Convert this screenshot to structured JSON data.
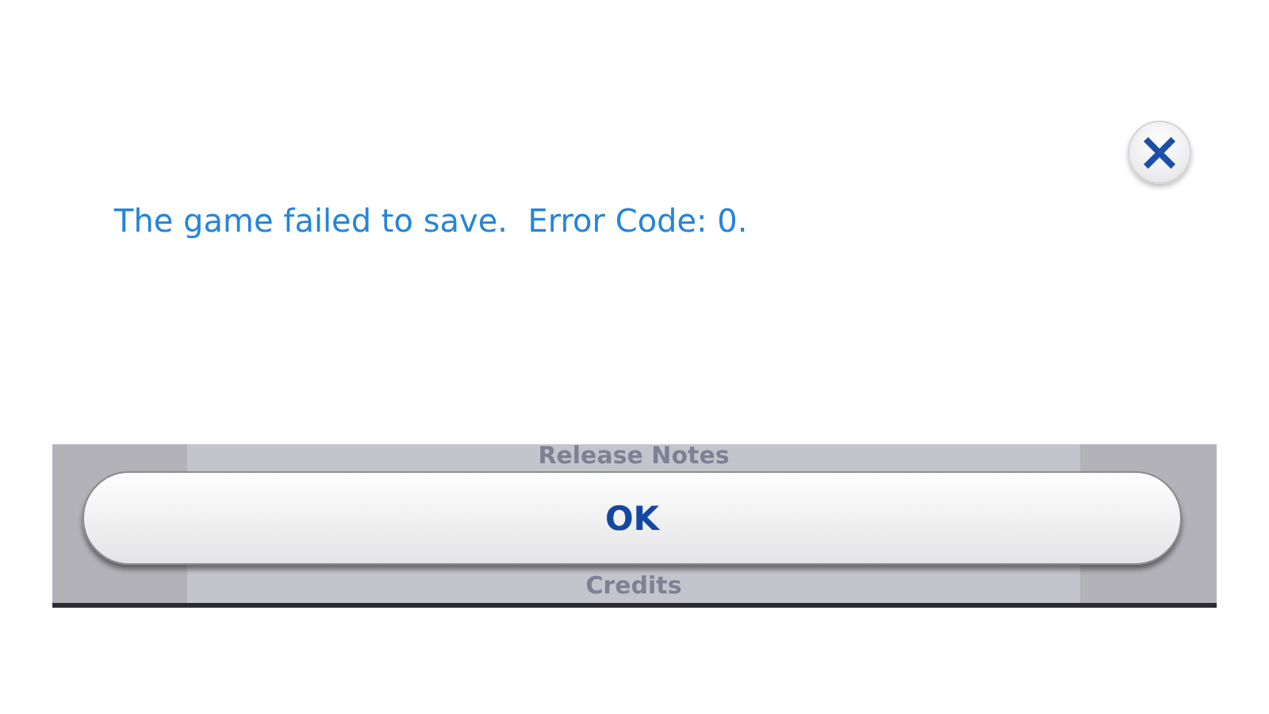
{
  "dialog": {
    "message": "The game failed to save.  Error Code: 0.",
    "close_button": {
      "label": "×"
    },
    "ok_button": {
      "label": "OK"
    }
  },
  "background_menu": [
    "Release Notes",
    "Credits"
  ]
}
